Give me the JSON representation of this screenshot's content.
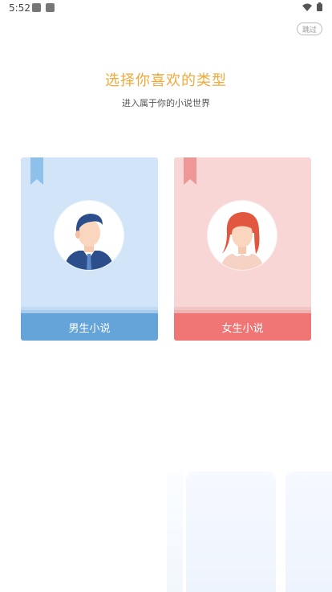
{
  "status_bar": {
    "time": "5:52",
    "icons": [
      "notification-square-icon",
      "notification-square-icon",
      "wifi-icon",
      "battery-icon"
    ]
  },
  "skip_label": "跳过",
  "title": "选择你喜欢的类型",
  "subtitle": "进入属于你的小说世界",
  "cards": [
    {
      "label": "男生小说",
      "icon": "male-avatar-icon",
      "accent": "#64a4d8",
      "bookmark": "#8fc0ea"
    },
    {
      "label": "女生小说",
      "icon": "female-avatar-icon",
      "accent": "#ef7675",
      "bookmark": "#ef9797"
    }
  ],
  "colors": {
    "title": "#f2a93b",
    "male_card_bg": "#d2e5f8",
    "female_card_bg": "#f8d6d6"
  }
}
